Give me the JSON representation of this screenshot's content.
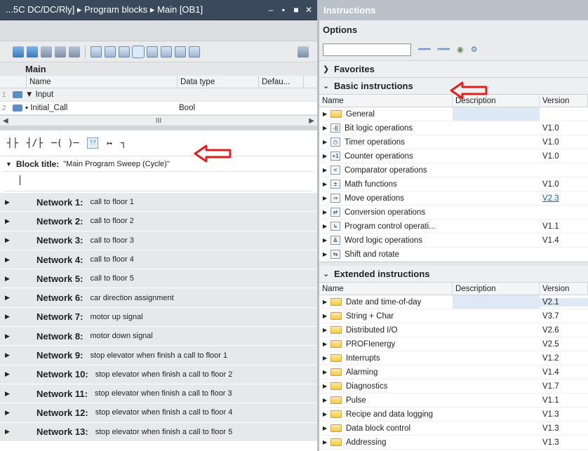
{
  "left": {
    "title": "...5C DC/DC/Rly] ▸ Program blocks ▸ Main [OB1]",
    "window_buttons": [
      "–",
      "▪",
      "■",
      "✕"
    ],
    "block_name": "Main",
    "interface_headers": {
      "name": "Name",
      "datatype": "Data type",
      "default": "Defau..."
    },
    "interface_rows": [
      {
        "num": "1",
        "name": "▼ Input",
        "datatype": ""
      },
      {
        "num": "2",
        "name": "▪     Initial_Call",
        "datatype": "Bool"
      }
    ],
    "hscroll_mid": "III",
    "ladder_elements": [
      "┤├",
      "┤/├",
      "─( )─",
      "??",
      "↦",
      "┐"
    ],
    "block_title_label": "Block title:",
    "block_title_value": "\"Main Program Sweep (Cycle)\"",
    "networks": [
      {
        "label": "Network 1:",
        "comment": "call to floor 1"
      },
      {
        "label": "Network 2:",
        "comment": "call to floor 2"
      },
      {
        "label": "Network 3:",
        "comment": "call to floor 3"
      },
      {
        "label": "Network 4:",
        "comment": "call to floor 4"
      },
      {
        "label": "Network 5:",
        "comment": "call to floor 5"
      },
      {
        "label": "Network 6:",
        "comment": "car direction assignment"
      },
      {
        "label": "Network 7:",
        "comment": "motor up signal"
      },
      {
        "label": "Network 8:",
        "comment": "motor down signal"
      },
      {
        "label": "Network 9:",
        "comment": "stop elevator when finish a call to floor 1"
      },
      {
        "label": "Network 10:",
        "comment": "stop elevator when finish a call to floor 2"
      },
      {
        "label": "Network 11:",
        "comment": "stop elevator when finish a call to floor 3"
      },
      {
        "label": "Network 12:",
        "comment": "stop elevator when finish a call to floor 4"
      },
      {
        "label": "Network 13:",
        "comment": "stop elevator when finish a call to floor 5"
      }
    ]
  },
  "right": {
    "title": "Instructions",
    "options_label": "Options",
    "search_placeholder": "",
    "favorites_label": "Favorites",
    "basic_label": "Basic instructions",
    "extended_label": "Extended instructions",
    "table_headers": {
      "name": "Name",
      "description": "Description",
      "version": "Version"
    },
    "basic_rows": [
      {
        "name": "General",
        "icon": "folder",
        "glyph": "",
        "version": "",
        "link": false
      },
      {
        "name": "Bit logic operations",
        "icon": "bit-logic",
        "glyph": "-||",
        "version": "V1.0",
        "link": false
      },
      {
        "name": "Timer operations",
        "icon": "timer",
        "glyph": "◷",
        "version": "V1.0",
        "link": false
      },
      {
        "name": "Counter operations",
        "icon": "counter",
        "glyph": "+1",
        "version": "V1.0",
        "link": false
      },
      {
        "name": "Comparator operations",
        "icon": "comparator",
        "glyph": "<",
        "version": "",
        "link": false
      },
      {
        "name": "Math functions",
        "icon": "math",
        "glyph": "±",
        "version": "V1.0",
        "link": false
      },
      {
        "name": "Move operations",
        "icon": "move",
        "glyph": "⇒",
        "version": "V2.3",
        "link": true
      },
      {
        "name": "Conversion operations",
        "icon": "conversion",
        "glyph": "⇄",
        "version": "",
        "link": false
      },
      {
        "name": "Program control operati...",
        "icon": "program-control",
        "glyph": "↳",
        "version": "V1.1",
        "link": false
      },
      {
        "name": "Word logic operations",
        "icon": "word-logic",
        "glyph": "&",
        "version": "V1.4",
        "link": false
      },
      {
        "name": "Shift and rotate",
        "icon": "shift",
        "glyph": "⇆",
        "version": "",
        "link": false
      }
    ],
    "extended_rows": [
      {
        "name": "Date and time-of-day",
        "version": "V2.1"
      },
      {
        "name": "String + Char",
        "version": "V3.7"
      },
      {
        "name": "Distributed I/O",
        "version": "V2.6"
      },
      {
        "name": "PROFIenergy",
        "version": "V2.5"
      },
      {
        "name": "Interrupts",
        "version": "V1.2"
      },
      {
        "name": "Alarming",
        "version": "V1.4"
      },
      {
        "name": "Diagnostics",
        "version": "V1.7"
      },
      {
        "name": "Pulse",
        "version": "V1.1"
      },
      {
        "name": "Recipe and data logging",
        "version": "V1.3"
      },
      {
        "name": "Data block control",
        "version": "V1.3"
      },
      {
        "name": "Addressing",
        "version": "V1.3"
      }
    ]
  },
  "colors": {
    "title_bar": "#3a4a5c",
    "right_title_bar": "#b9c1c9",
    "annotation_arrow": "#e02020",
    "link": "#1a5bc4"
  }
}
